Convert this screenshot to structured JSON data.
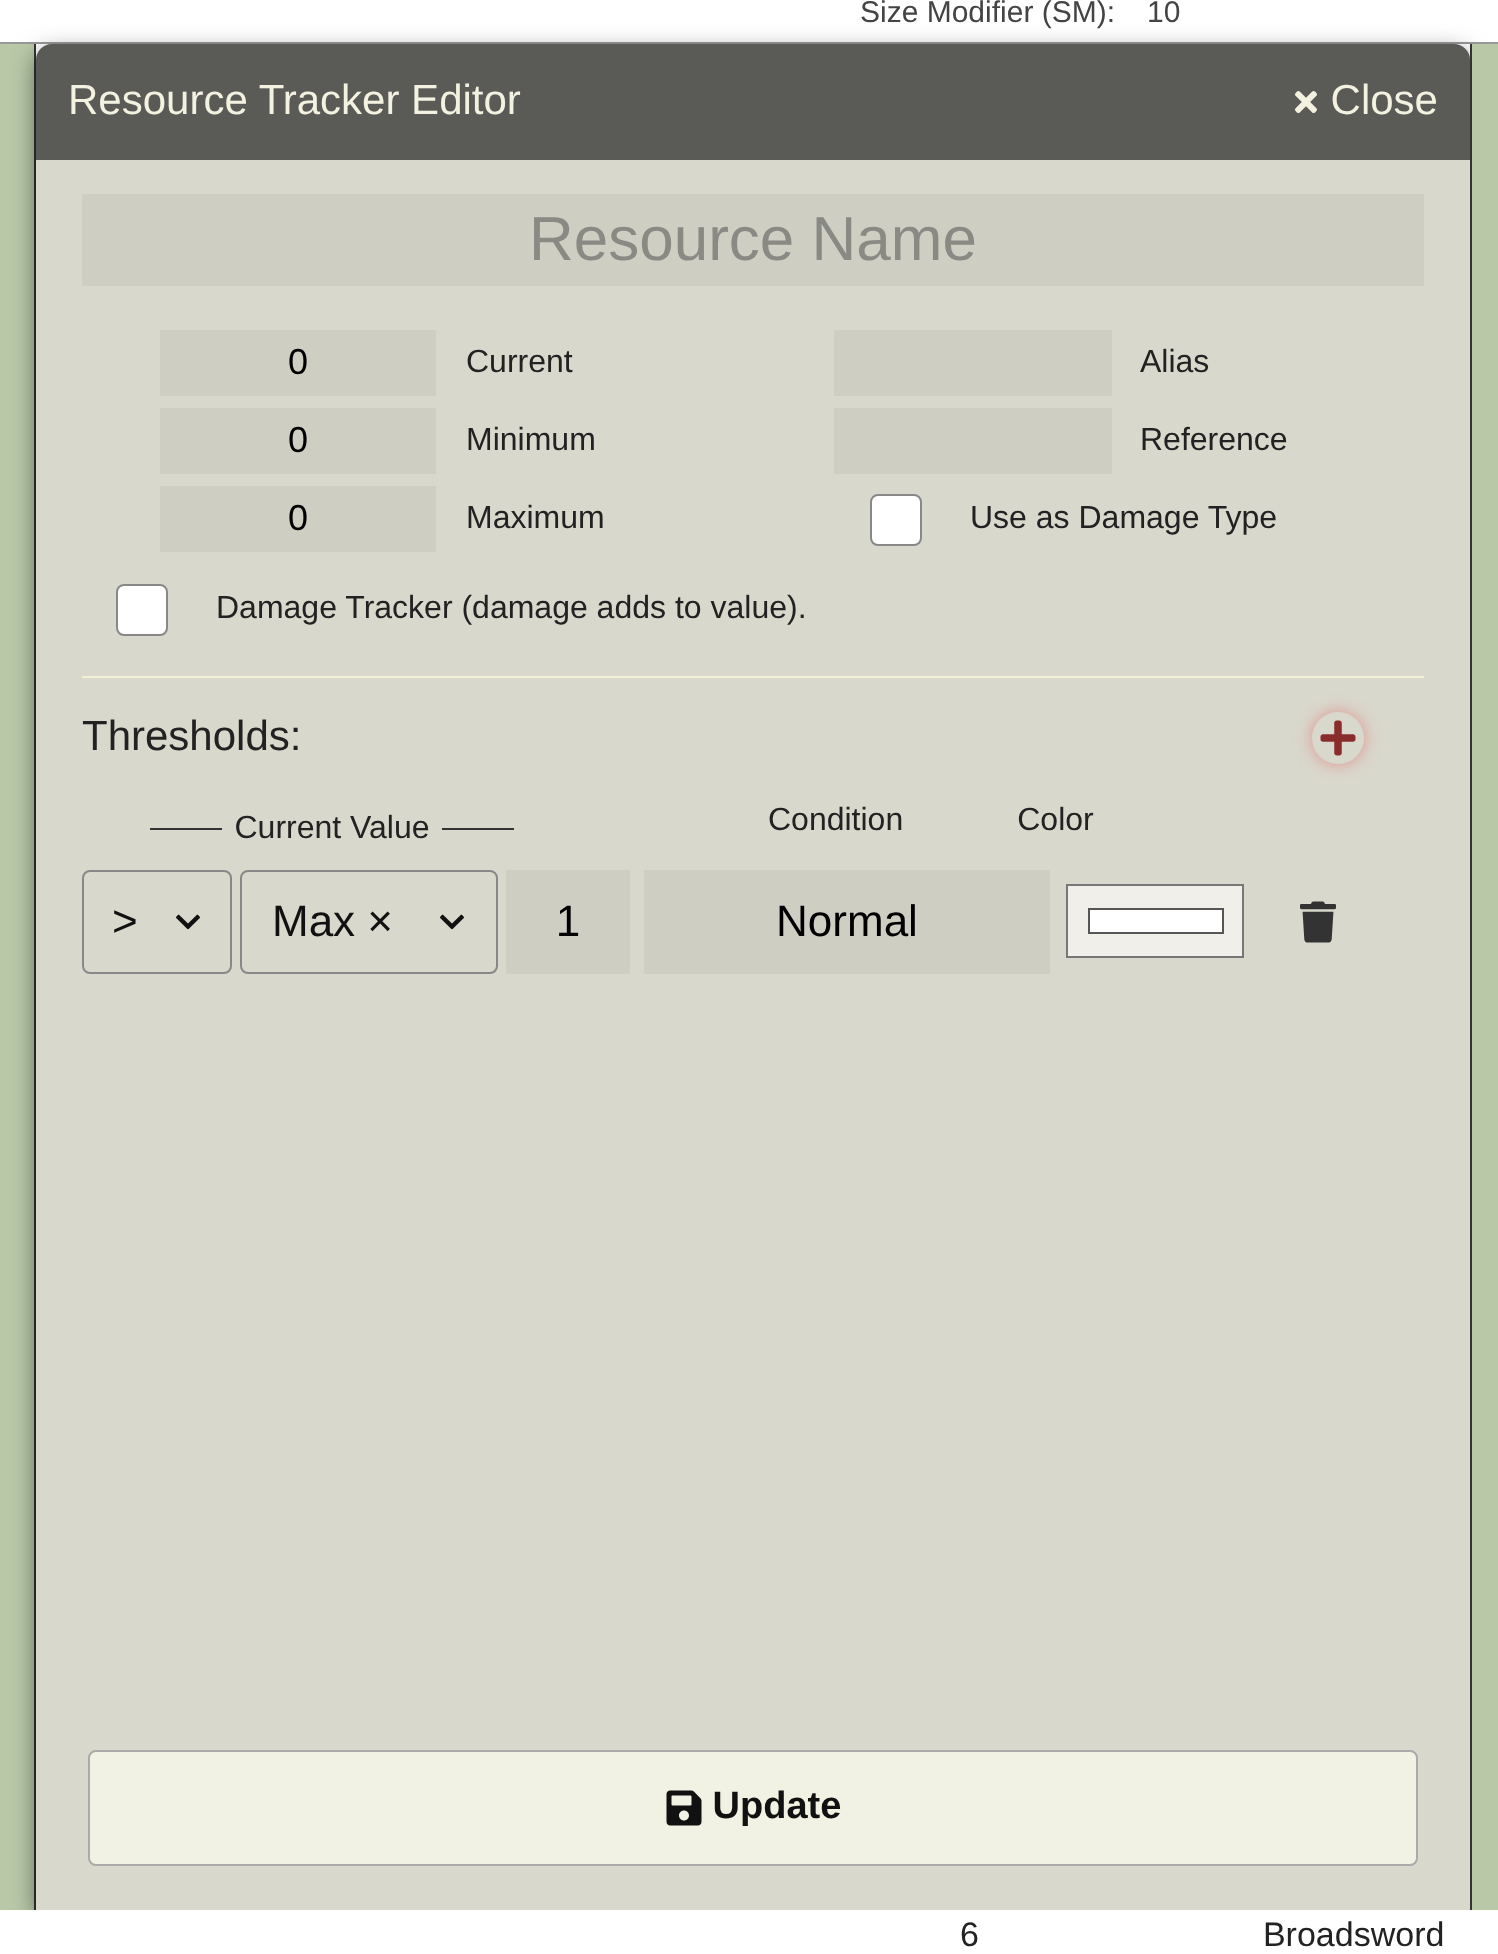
{
  "background": {
    "top_label": "Size Modifier (SM):",
    "top_value": "10",
    "bottom_number": "6",
    "bottom_item": "Broadsword"
  },
  "dialog": {
    "title": "Resource Tracker Editor",
    "close": "Close",
    "name_placeholder": "Resource Name",
    "left_fields": [
      {
        "value": "0",
        "label": "Current"
      },
      {
        "value": "0",
        "label": "Minimum"
      },
      {
        "value": "0",
        "label": "Maximum"
      }
    ],
    "right_fields": [
      {
        "kind": "field",
        "label": "Alias"
      },
      {
        "kind": "field",
        "label": "Reference"
      },
      {
        "kind": "checkbox",
        "checked": false,
        "label": "Use as Damage Type"
      }
    ],
    "damage_tracker": {
      "checked": false,
      "label": "Damage Tracker (damage adds to value)."
    },
    "thresholds": {
      "title": "Thresholds:",
      "headers": {
        "current_value": "Current Value",
        "condition": "Condition",
        "swatch": "Color"
      },
      "rows": [
        {
          "operator": ">",
          "base": "Max ×",
          "factor": "1",
          "condition": "Normal",
          "color": "#ffffff"
        }
      ]
    },
    "update_button": "Update"
  }
}
